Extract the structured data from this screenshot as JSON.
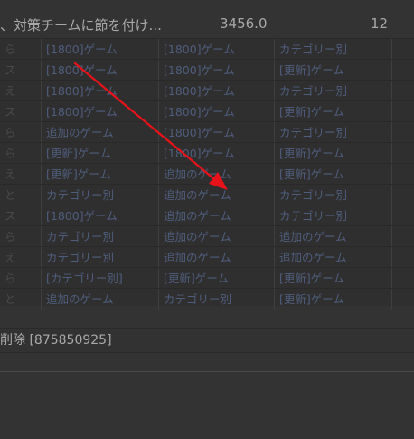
{
  "top_row": {
    "text": "、対策チームに節を付け...",
    "value": "3456.0",
    "count": "12"
  },
  "table": {
    "rows": [
      [
        "ら",
        "[1800]ゲーム",
        "[1800]ゲーム",
        "カテゴリー別",
        ""
      ],
      [
        "ス",
        "[1800]ゲーム",
        "[1800]ゲーム",
        "[更新]ゲーム",
        ""
      ],
      [
        "え",
        "[1800]ゲーム",
        "[1800]ゲーム",
        "カテゴリー別",
        ""
      ],
      [
        "ス",
        "[1800]ゲーム",
        "[1800]ゲーム",
        "[更新]ゲーム",
        ""
      ],
      [
        "ら",
        "追加のゲーム",
        "[1800]ゲーム",
        "カテゴリー別",
        ""
      ],
      [
        "ら",
        "[更新]ゲーム",
        "[1800]ゲーム",
        "[更新]ゲーム",
        ""
      ],
      [
        "え",
        "[更新]ゲーム",
        "追加のゲーム",
        "[更新]ゲーム",
        ""
      ],
      [
        "と",
        "カテゴリー別",
        "追加のゲーム",
        "カテゴリー別",
        ""
      ],
      [
        "ス",
        "[1800]ゲーム",
        "追加のゲーム",
        "カテゴリー別",
        ""
      ],
      [
        "ら",
        "カテゴリー別",
        "追加のゲーム",
        "追加のゲーム",
        ""
      ],
      [
        "え",
        "カテゴリー別",
        "追加のゲーム",
        "追加のゲーム",
        ""
      ],
      [
        "ら",
        "[カテゴリー別]",
        "[更新]ゲーム",
        "[更新]ゲーム",
        ""
      ],
      [
        "と",
        "追加のゲーム",
        "カテゴリー別",
        "[更新]ゲーム",
        ""
      ]
    ]
  },
  "status_bar": {
    "text": "削除 [875850925]"
  },
  "annotation": {
    "color": "#e8131a"
  }
}
